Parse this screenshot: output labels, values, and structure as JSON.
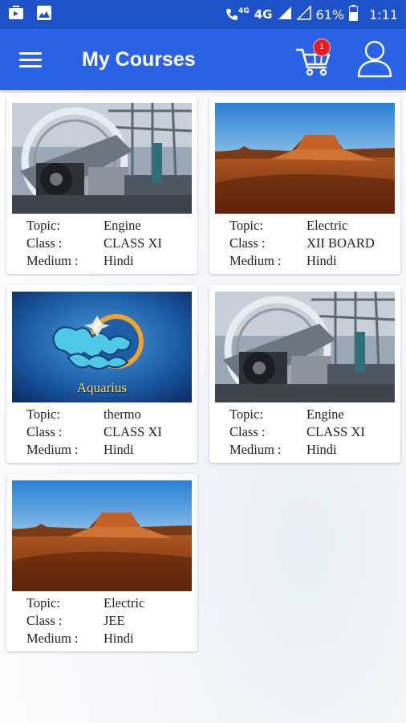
{
  "status_bar": {
    "net_small": "4G",
    "net": "4G",
    "battery": "61%",
    "time": "1:11"
  },
  "app_bar": {
    "title": "My Courses",
    "cart_count": "1"
  },
  "labels": {
    "topic": "Topic:",
    "class": "Class :",
    "medium": "Medium :"
  },
  "courses": [
    {
      "topic": "Engine",
      "class": "CLASS XI",
      "medium": "Hindi",
      "image": "engine"
    },
    {
      "topic": "Electric",
      "class": "XII BOARD",
      "medium": "Hindi",
      "image": "desert"
    },
    {
      "topic": "thermo",
      "class": "CLASS XI",
      "medium": "Hindi",
      "image": "aquarius",
      "image_caption": "Aquarius"
    },
    {
      "topic": "Engine",
      "class": "CLASS XI",
      "medium": "Hindi",
      "image": "engine"
    },
    {
      "topic": "Electric",
      "class": "JEE",
      "medium": "Hindi",
      "image": "desert"
    }
  ],
  "colors": {
    "status_bar": "#1e52c9",
    "app_bar": "#2a62e6",
    "badge": "#e51c23"
  }
}
